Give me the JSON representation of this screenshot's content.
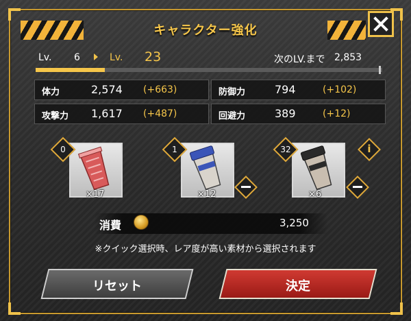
{
  "dialog": {
    "title": "キャラクター強化",
    "close_label": "×"
  },
  "level": {
    "prefix": "Lv.",
    "current": "6",
    "next": "23",
    "to_next_label": "次のLV.まで",
    "to_next_value": "2,853",
    "progress": 0.2
  },
  "stats": [
    {
      "name": "体力",
      "value": "2,574",
      "bonus": "(+663)"
    },
    {
      "name": "防御力",
      "value": "794",
      "bonus": "(+102)"
    },
    {
      "name": "攻撃力",
      "value": "1,617",
      "bonus": "(+487)"
    },
    {
      "name": "回避力",
      "value": "389",
      "bonus": "(+12)"
    }
  ],
  "materials": [
    {
      "selected": "0",
      "stock": "×17",
      "color": "#d85a5a",
      "icon": "red-cup-icon"
    },
    {
      "selected": "1",
      "stock": "×12",
      "color": "#3b55b8",
      "icon": "blue-cup-icon"
    },
    {
      "selected": "32",
      "stock": "×6",
      "color": "#2a2a2a",
      "icon": "black-cup-icon"
    }
  ],
  "cost": {
    "label": "消費",
    "value": "3,250",
    "icon": "coin-icon"
  },
  "note": "※クイック選択時、レア度が高い素材から選択されます",
  "buttons": {
    "reset": "リセット",
    "confirm": "決定"
  },
  "colors": {
    "accent": "#f6c64a",
    "frame": "#c99a2e",
    "confirm": "#c8302a"
  }
}
